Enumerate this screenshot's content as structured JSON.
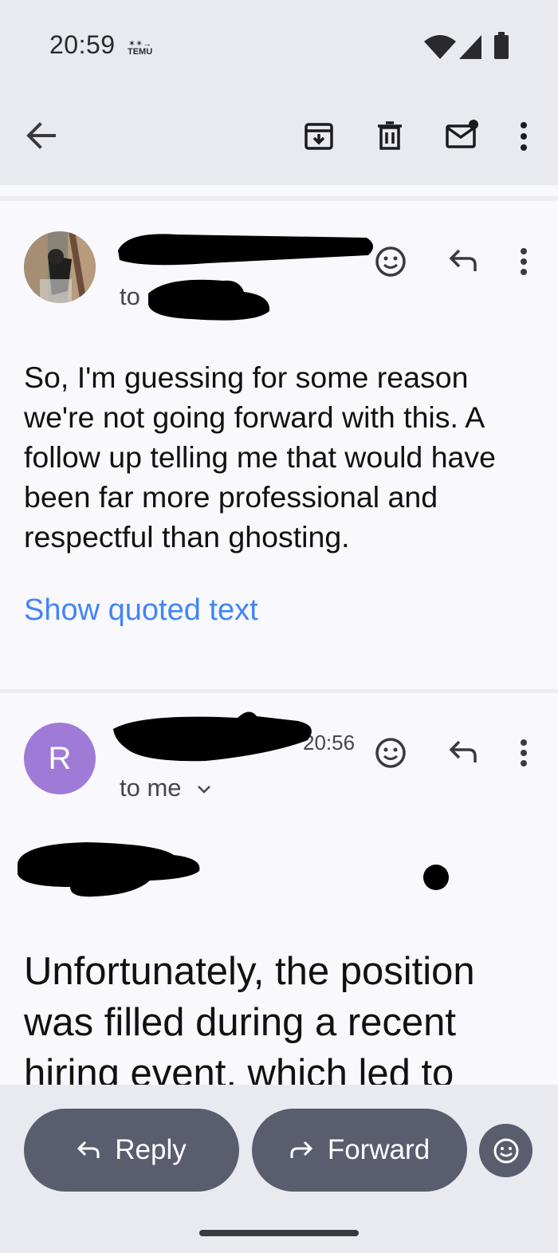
{
  "status_bar": {
    "time": "20:59",
    "notification_badge_line1": "✶✴→",
    "notification_badge_line2": "TEMU"
  },
  "toolbar": {
    "back_icon": "arrow-back-icon",
    "archive_icon": "archive-icon",
    "delete_icon": "trash-icon",
    "mark_unread_icon": "mail-unread-icon",
    "more_icon": "more-vert-icon"
  },
  "messages": [
    {
      "to_label": "to",
      "body": "So, I'm guessing for some reason we're not going forward with this. A follow up telling me that would have been far more professional and respectful than ghosting.",
      "show_quoted": "Show quoted text"
    },
    {
      "avatar_letter": "R",
      "time_fragment": "20:56",
      "to_label": "to me",
      "body": "Unfortunately, the position was filled during a recent hiring event, which led to"
    }
  ],
  "actions": {
    "reply_label": "Reply",
    "forward_label": "Forward"
  },
  "colors": {
    "link": "#4285f4",
    "avatar_bg": "#9f7ad6",
    "pill_bg": "#5a5d6e",
    "topbar_bg": "#e9e9f0"
  }
}
